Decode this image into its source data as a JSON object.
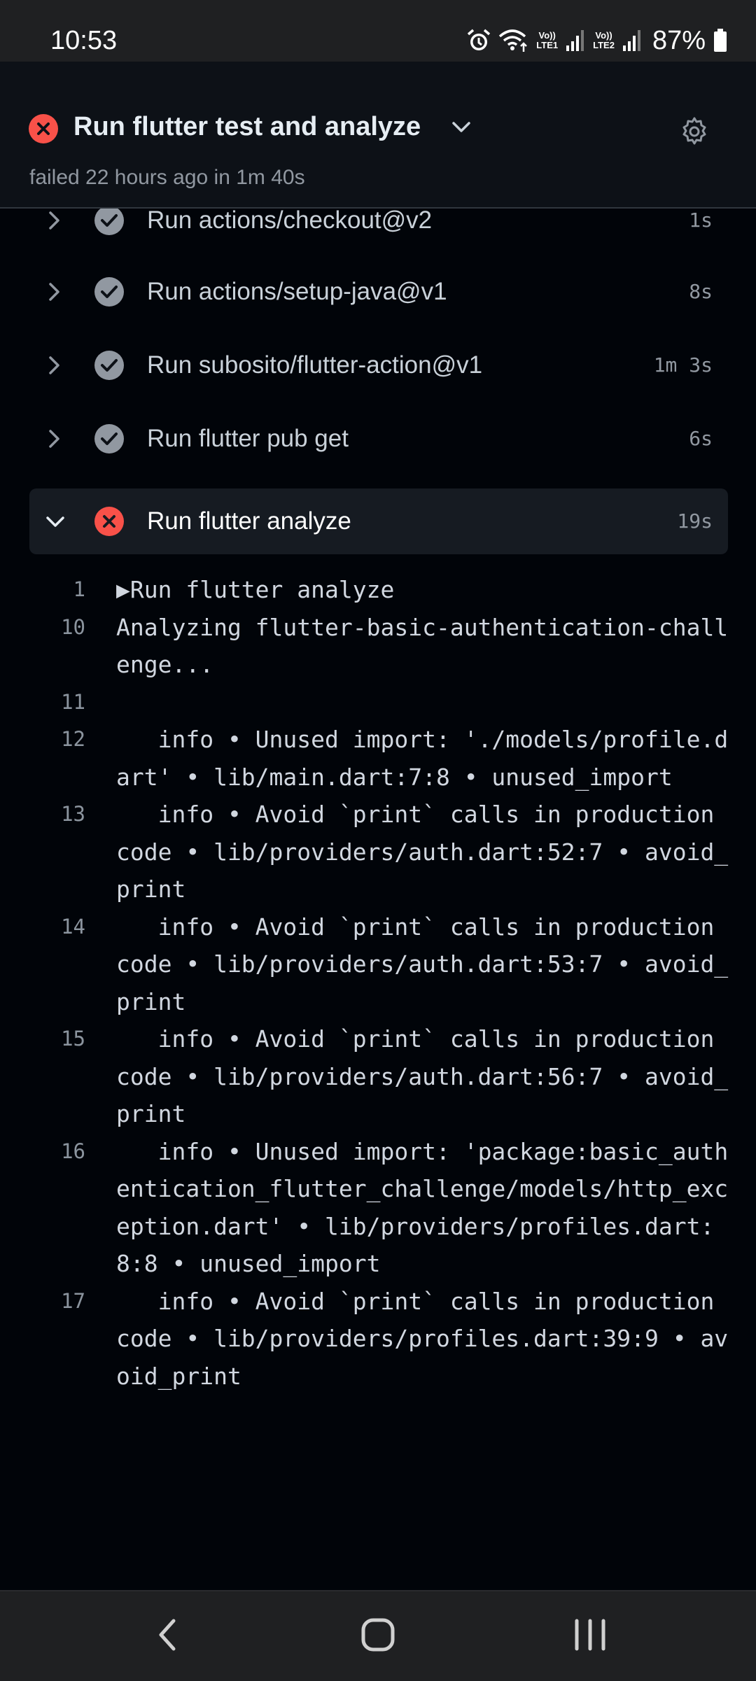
{
  "status_bar": {
    "time": "10:53",
    "sim1_label": "Vo))\nLTE1",
    "sim2_label": "Vo))\nLTE2",
    "battery": "87%"
  },
  "header": {
    "title": "Run flutter test and analyze",
    "subtitle": "failed 22 hours ago in 1m 40s"
  },
  "steps": [
    {
      "name": "Run actions/checkout@v2",
      "duration": "1s",
      "status": "success"
    },
    {
      "name": "Run actions/setup-java@v1",
      "duration": "8s",
      "status": "success"
    },
    {
      "name": "Run subosito/flutter-action@v1",
      "duration": "1m 3s",
      "status": "success"
    },
    {
      "name": "Run flutter pub get",
      "duration": "6s",
      "status": "success"
    },
    {
      "name": "Run flutter analyze",
      "duration": "19s",
      "status": "failure",
      "expanded": true
    }
  ],
  "log": [
    {
      "n": "1",
      "text": "▶Run flutter analyze"
    },
    {
      "n": "10",
      "text": "Analyzing flutter-basic-authentication-challenge..."
    },
    {
      "n": "11",
      "text": ""
    },
    {
      "n": "12",
      "text": "   info • Unused import: './models/profile.dart' • lib/main.dart:7:8 • unused_import"
    },
    {
      "n": "13",
      "text": "   info • Avoid `print` calls in production code • lib/providers/auth.dart:52:7 • avoid_print"
    },
    {
      "n": "14",
      "text": "   info • Avoid `print` calls in production code • lib/providers/auth.dart:53:7 • avoid_print"
    },
    {
      "n": "15",
      "text": "   info • Avoid `print` calls in production code • lib/providers/auth.dart:56:7 • avoid_print"
    },
    {
      "n": "16",
      "text": "   info • Unused import: 'package:basic_authentication_flutter_challenge/models/http_exception.dart' • lib/providers/profiles.dart:8:8 • unused_import"
    },
    {
      "n": "17",
      "text": "   info • Avoid `print` calls in production code • lib/providers/profiles.dart:39:9 • avoid_print"
    }
  ],
  "colors": {
    "background": "#010409",
    "header_bg": "#0d1117",
    "failure": "#f85149",
    "success_icon": "#9198a1",
    "muted_text": "#9198a1"
  }
}
